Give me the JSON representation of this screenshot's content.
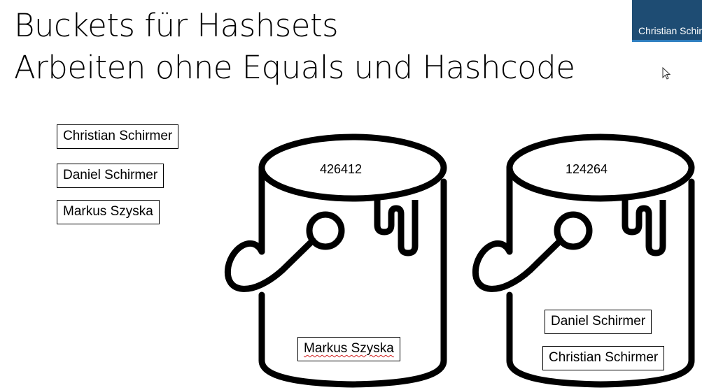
{
  "slide": {
    "title_line_1": "Buckets für Hashsets",
    "title_line_2": "Arbeiten ohne Equals und Hashcode"
  },
  "presenter_badge": {
    "name": "Christian Schirmer",
    "background": "#1e4c73",
    "accent": "#2f7fc0"
  },
  "unsorted_names": [
    "Christian Schirmer",
    "Daniel Schirmer",
    "Markus Szyska"
  ],
  "buckets": [
    {
      "hash": "426412",
      "contents": [
        "Markus Szyska"
      ]
    },
    {
      "hash": "124264",
      "contents": [
        "Daniel Schirmer",
        "Christian Schirmer"
      ]
    }
  ],
  "icons": {
    "bucket": "paint-bucket-icon",
    "cursor": "mouse-pointer-icon"
  }
}
